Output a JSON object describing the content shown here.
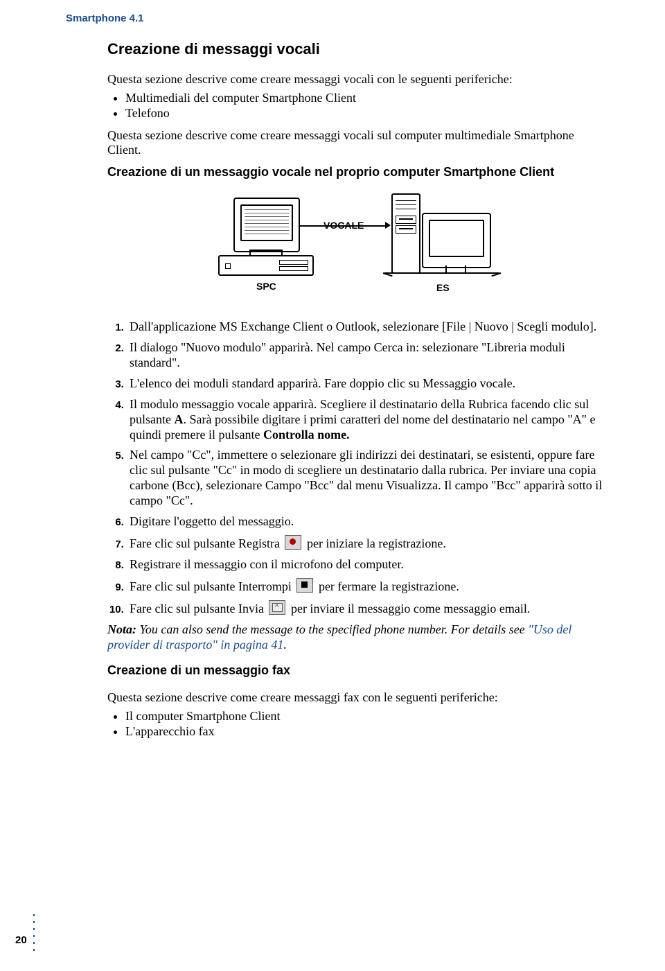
{
  "runningHead": "Smartphone 4.1",
  "h1": "Creazione di messaggi vocali",
  "intro1": "Questa sezione descrive come creare messaggi vocali con le seguenti periferiche:",
  "introBullets": [
    "Multimediali del computer Smartphone Client",
    "Telefono"
  ],
  "intro2": "Questa sezione descrive come creare messaggi vocali sul computer multimediale Smartphone Client.",
  "h2a": "Creazione di un messaggio vocale nel proprio computer Smartphone Client",
  "diagram": {
    "vocale": "VOCALE",
    "spc": "SPC",
    "es": "ES"
  },
  "steps": {
    "s1": "Dall'applicazione MS Exchange Client o Outlook, selezionare [File | Nuovo | Scegli modulo].",
    "s2": "Il dialogo \"Nuovo modulo\" apparirà. Nel campo Cerca in: selezionare \"Libreria moduli standard\".",
    "s3": "L'elenco dei moduli standard apparirà. Fare doppio clic su Messaggio vocale.",
    "s4_a": "Il modulo messaggio vocale apparirà. Scegliere il destinatario della Rubrica facendo clic sul pulsante ",
    "s4_b": "A",
    "s4_c": ". Sarà possibile digitare i primi caratteri del nome del destinatario nel campo \"A\" e quindi premere il pulsante ",
    "s4_d": "Controlla nome.",
    "s5": "Nel campo \"Cc\", immettere o selezionare gli indirizzi dei destinatari, se esistenti, oppure fare clic sul pulsante \"Cc\" in modo di scegliere un destinatario dalla rubrica. Per inviare una copia carbone (Bcc), selezionare Campo \"Bcc\" dal menu Visualizza. Il campo \"Bcc\" apparirà sotto il campo \"Cc\".",
    "s6": "Digitare l'oggetto del messaggio.",
    "s7_a": "Fare clic sul pulsante Registra ",
    "s7_b": " per iniziare la registrazione.",
    "s8": "Registrare il messaggio con il microfono del computer.",
    "s9_a": "Fare clic sul pulsante Interrompi ",
    "s9_b": " per fermare la registrazione.",
    "s10_a": "Fare clic sul pulsante Invia ",
    "s10_b": " per inviare il messaggio come messaggio email."
  },
  "note": {
    "label": "Nota:",
    "body": " You can also send the message to the specified phone number. For details see ",
    "xref": "\"Uso del provider di trasporto\" in pagina 41",
    "tail": "."
  },
  "h2b": "Creazione di un messaggio fax",
  "faxIntro": "Questa sezione descrive come creare messaggi fax con le seguenti periferiche:",
  "faxBullets": [
    "Il computer Smartphone Client",
    "L'apparecchio fax"
  ],
  "pageNumber": "20"
}
